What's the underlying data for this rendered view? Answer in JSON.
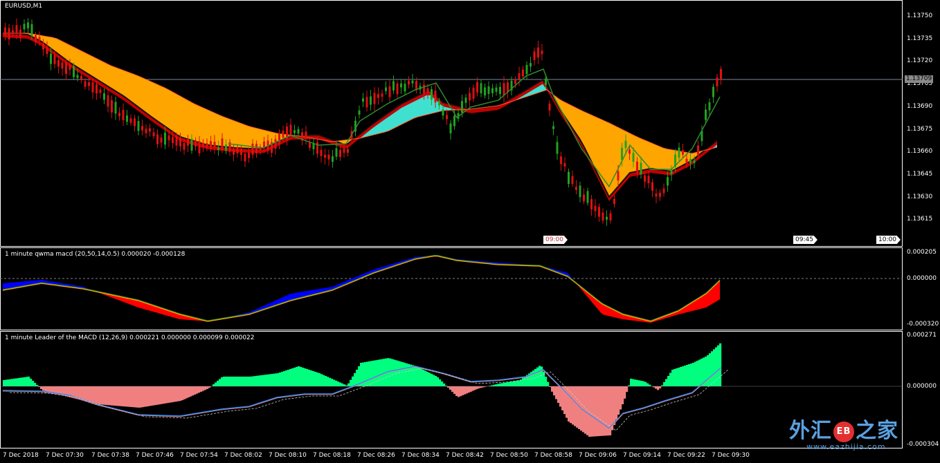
{
  "main_pane": {
    "label": "EURUSD,M1",
    "current_price": "1.13709"
  },
  "price_axis": [
    "1.13750",
    "1.13735",
    "1.13720",
    "1.13705",
    "1.13690",
    "1.13675",
    "1.13660",
    "1.13645",
    "1.13630",
    "1.13615"
  ],
  "time_markers": [
    "09:00",
    "09:45",
    "10:00"
  ],
  "macd_pane": {
    "label": "1 minute qwma macd (20,50,14,0.5) 0.000020 -0.000128",
    "axis": [
      "0.000205",
      "0.000000",
      "-0.000320"
    ]
  },
  "leader_pane": {
    "label": "1 minute Leader of the MACD (12,26,9) 0.000221 0.000000 0.000099 0.000022",
    "axis": [
      "0.000271",
      "0.000000",
      "-0.000304"
    ]
  },
  "x_axis": [
    "7 Dec 2018",
    "7 Dec 07:30",
    "7 Dec 07:38",
    "7 Dec 07:46",
    "7 Dec 07:54",
    "7 Dec 08:02",
    "7 Dec 08:10",
    "7 Dec 08:18",
    "7 Dec 08:26",
    "7 Dec 08:34",
    "7 Dec 08:42",
    "7 Dec 08:50",
    "7 Dec 08:58",
    "7 Dec 09:06",
    "7 Dec 09:14",
    "7 Dec 09:22",
    "7 Dec 09:30"
  ],
  "watermark": {
    "text_left": "外汇",
    "seal": "EB",
    "text_right": "之家",
    "url": "www.eazhijia.com"
  },
  "colors": {
    "up_candle": "#1fa31f",
    "down_candle": "#e01010",
    "ribbon_orange": "#ffa500",
    "ribbon_cyan": "#40e0d0",
    "macd_red": "#ff0000",
    "macd_blue": "#0000ff",
    "hist_green": "#00ff7f",
    "hist_pink": "#f08080",
    "signal_line": "#1e90ff"
  }
}
